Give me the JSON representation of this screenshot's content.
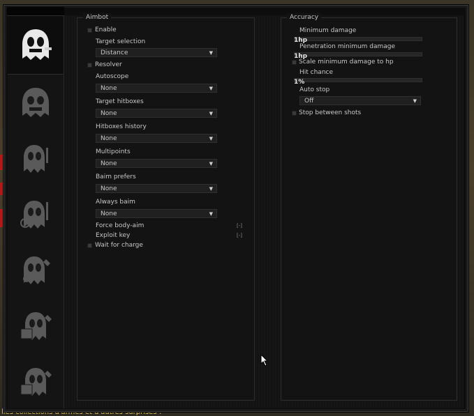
{
  "backdrop": {
    "footer_text": "lles collections d'armes et d'autres surprises !"
  },
  "sidebar": {
    "tabs": [
      {
        "id": "rage",
        "icon": "ghost-aimbot-icon",
        "active": true
      },
      {
        "id": "antiaim",
        "icon": "ghost-antiaim-icon",
        "active": false
      },
      {
        "id": "legit",
        "icon": "ghost-legit-icon",
        "active": false
      },
      {
        "id": "visuals",
        "icon": "ghost-visuals-icon",
        "active": false
      },
      {
        "id": "misc",
        "icon": "ghost-misc-icon",
        "active": false
      },
      {
        "id": "skins",
        "icon": "ghost-skins-icon",
        "active": false
      },
      {
        "id": "config",
        "icon": "ghost-config-icon",
        "active": false
      }
    ]
  },
  "aimbot": {
    "title": "Aimbot",
    "enable_label": "Enable",
    "target_selection_label": "Target selection",
    "target_selection_value": "Distance",
    "resolver_label": "Resolver",
    "autoscope_label": "Autoscope",
    "autoscope_value": "None",
    "target_hitboxes_label": "Target hitboxes",
    "target_hitboxes_value": "None",
    "hitboxes_history_label": "Hitboxes history",
    "hitboxes_history_value": "None",
    "multipoints_label": "Multipoints",
    "multipoints_value": "None",
    "baim_prefers_label": "Baim prefers",
    "baim_prefers_value": "None",
    "always_baim_label": "Always baim",
    "always_baim_value": "None",
    "force_body_aim_label": "Force body-aim",
    "force_body_aim_key": "[-]",
    "exploit_key_label": "Exploit key",
    "exploit_key_key": "[-]",
    "wait_for_charge_label": "Wait for charge"
  },
  "accuracy": {
    "title": "Accuracy",
    "minimum_damage_label": "Minimum damage",
    "minimum_damage_value": "1hp",
    "penetration_minimum_damage_label": "Penetration minimum damage",
    "penetration_minimum_damage_value": "1hp",
    "scale_minimum_damage_label": "Scale minimum damage to hp",
    "hit_chance_label": "Hit chance",
    "hit_chance_value": "1%",
    "auto_stop_label": "Auto stop",
    "auto_stop_value": "Off",
    "stop_between_shots_label": "Stop between shots"
  },
  "colors": {
    "background": "#0e0e0e",
    "panel": "#131313",
    "border": "#2e2e2e",
    "text": "#c8c8c8",
    "checkbox": "#3a3a3a"
  }
}
